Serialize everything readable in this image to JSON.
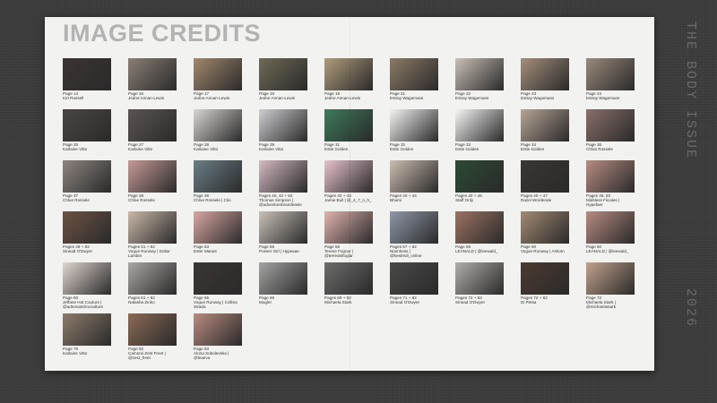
{
  "title": "IMAGE CREDITS",
  "side_title": "THE BODY ISSUE",
  "side_year": "2026",
  "credits": [
    {
      "caption": "Page 14\nKirt Russell",
      "color": "#3b3432"
    },
    {
      "caption": "Page 16\nJedne Annan-Lewin",
      "color": "#8a7f76"
    },
    {
      "caption": "Page 17\nJedne Annan-Lewin",
      "color": "#a2886e"
    },
    {
      "caption": "Page 18\nJedne Annan-Lewin",
      "color": "#6f6a55"
    },
    {
      "caption": "Page 19\nJedne Annan-Lewin",
      "color": "#b09c7d"
    },
    {
      "caption": "Page 21\nEstray Wagemans",
      "color": "#8b7a66"
    },
    {
      "caption": "Page 22\nEstray Wagemans",
      "color": "#c9bfb6"
    },
    {
      "caption": "Page 23\nEstray Wagemans",
      "color": "#a58e7b"
    },
    {
      "caption": "Page 24\nEstray Wagemans",
      "color": "#9a8a7c"
    },
    {
      "caption": "Page 26\nKarlaine Vitto",
      "color": "#4a4542"
    },
    {
      "caption": "Page 27\nKarlaine Vitto",
      "color": "#5b5552"
    },
    {
      "caption": "Page 28\nKarlaine Vitto",
      "color": "#d8d6d4"
    },
    {
      "caption": "Page 29\nKarlaine Vitto",
      "color": "#cfcfd2"
    },
    {
      "caption": "Page 31\nEstie Golden",
      "color": "#3d7b5a"
    },
    {
      "caption": "Page 32\nEstie Golden",
      "color": "#f4f4f4"
    },
    {
      "caption": "Page 33\nEstie Golden",
      "color": "#f6f6f6"
    },
    {
      "caption": "Page 34\nEstie Golden",
      "color": "#b7a595"
    },
    {
      "caption": "Page 36\nChloe Rossele",
      "color": "#8a6f6a"
    },
    {
      "caption": "Page 37\nChloe Rossele",
      "color": "#8d8580"
    },
    {
      "caption": "Page 38\nChloe Rossele",
      "color": "#c69a96"
    },
    {
      "caption": "Page 39\nChloe Rossele | Clio",
      "color": "#6b7e86"
    },
    {
      "caption": "Pages 40, 42 + 82\nThomas Simpson | @adventurebrandeasie",
      "color": "#d6bac4"
    },
    {
      "caption": "Pages 40 + 43\nJamie Bull | @_4_7_n_h_",
      "color": "#e7c2cf"
    },
    {
      "caption": "Pages 40 + 44\nBhumi",
      "color": "#cdbdb0"
    },
    {
      "caption": "Pages 40 + 46\nStaff Only",
      "color": "#2b4a32"
    },
    {
      "caption": "Pages 40 + 47\nRazel Wordende",
      "color": "#3a3634"
    },
    {
      "caption": "Pages 48, 83\nMidsless Fiicales | Hypefaer",
      "color": "#b88c82"
    },
    {
      "caption": "Pages 48 + 82\nSinead O'Dwyer",
      "color": "#6d5244"
    },
    {
      "caption": "Pages 51 + 82\nVogue Runway | Dollar Lambin",
      "color": "#cbb8a8"
    },
    {
      "caption": "Page 53\nEster Manas",
      "color": "#d9a7a2"
    },
    {
      "caption": "Page 55\nPosser Girl | Hypeaae",
      "color": "#c9c1b8"
    },
    {
      "caption": "Page 56\nTerese Fognar | @terreastfoglar",
      "color": "#e0b4ae"
    },
    {
      "caption": "Pages 57 + 82\nNiamhess | @kestredi_online",
      "color": "#8f98a8"
    },
    {
      "caption": "Page 58\nLEANALD | @leewald_",
      "color": "#9b7363"
    },
    {
      "caption": "Page 60\nVogue Runway | Ashotn",
      "color": "#a48a74"
    },
    {
      "caption": "Page 60\nLEANALD | @leewald_",
      "color": "#b88b82"
    },
    {
      "caption": "Page 60\nJeffane Hot Couture | @adnenatshocoulture",
      "color": "#e1d6d0"
    },
    {
      "caption": "Pages 61 + 82\nNatasha Zinko",
      "color": "#aaa7a5"
    },
    {
      "caption": "Page 65\nVogue Runway | Collina Strada",
      "color": "#3b3633"
    },
    {
      "caption": "Page 66\nMugler",
      "color": "#a3a3a3"
    },
    {
      "caption": "Pages 69 + 82\nMichaela Stark",
      "color": "#6c6c6c"
    },
    {
      "caption": "Pages 71 + 82\nSinead O'Dwyer",
      "color": "#4b4a4b"
    },
    {
      "caption": "Pages 72 + 82\nSinead O'Dwyer",
      "color": "#b1aeac"
    },
    {
      "caption": "Pages 72 + 82\nDi Petsa",
      "color": "#4d3a30"
    },
    {
      "caption": "Page 72\nMichaela Stark | @michaelastark",
      "color": "#c2a28c"
    },
    {
      "caption": "Page 76\nKarlaine Vitto",
      "color": "#8e7c6b"
    },
    {
      "caption": "Page 82\nCamomi Zest Freet | @zest_freet",
      "color": "#8b6a55"
    },
    {
      "caption": "Page 83\nAlona Sobolevska | @leaeva",
      "color": "#b98c80"
    }
  ]
}
